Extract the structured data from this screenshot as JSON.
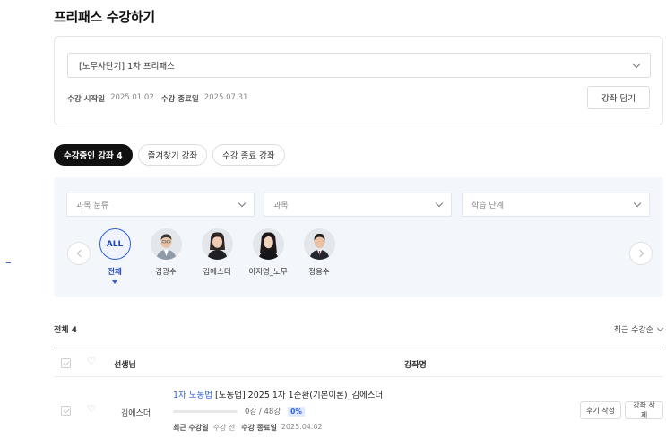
{
  "page": {
    "title": "프리패스 수강하기"
  },
  "pass": {
    "selected": "[노무사단기] 1차 프리패스",
    "start_label": "수강 시작일",
    "start_date": "2025.01.02",
    "end_label": "수강 종료일",
    "end_date": "2025.07.31",
    "cart_button": "강좌 담기"
  },
  "tabs": [
    {
      "label": "수강중인 강좌 4",
      "active": true
    },
    {
      "label": "즐겨찾기 강좌",
      "active": false
    },
    {
      "label": "수강 종료 강좌",
      "active": false
    }
  ],
  "filters": {
    "category": "과목 분류",
    "subject": "과목",
    "stage": "학습 단계"
  },
  "teachers": [
    {
      "name": "전체",
      "badge": "ALL",
      "selected": true
    },
    {
      "name": "김광수",
      "selected": false
    },
    {
      "name": "김에스더",
      "selected": false
    },
    {
      "name": "이지영_노무",
      "selected": false
    },
    {
      "name": "정용수",
      "selected": false
    }
  ],
  "list": {
    "count_label": "전체 4",
    "sort_label": "최근 수강순",
    "columns": {
      "teacher": "선생님",
      "course": "강좌명"
    }
  },
  "rows": [
    {
      "teacher": "김에스더",
      "subject": "1차 노동법",
      "title": "[노동법] 2025 1차 1순환(기본이론)_김에스더",
      "lectures": "0강 / 48강",
      "percent": "0%",
      "progress": 0,
      "recent_label": "최근 수강일",
      "recent_value": "수강 전",
      "end_label": "수강 종료일",
      "end_value": "2025.04.02",
      "review_button": "후기 작성",
      "delete_button": "강좌 삭제"
    }
  ],
  "colors": {
    "accent": "#2f5fe0",
    "panel_bg": "#f3f6fb",
    "active_tab_bg": "#111111"
  }
}
